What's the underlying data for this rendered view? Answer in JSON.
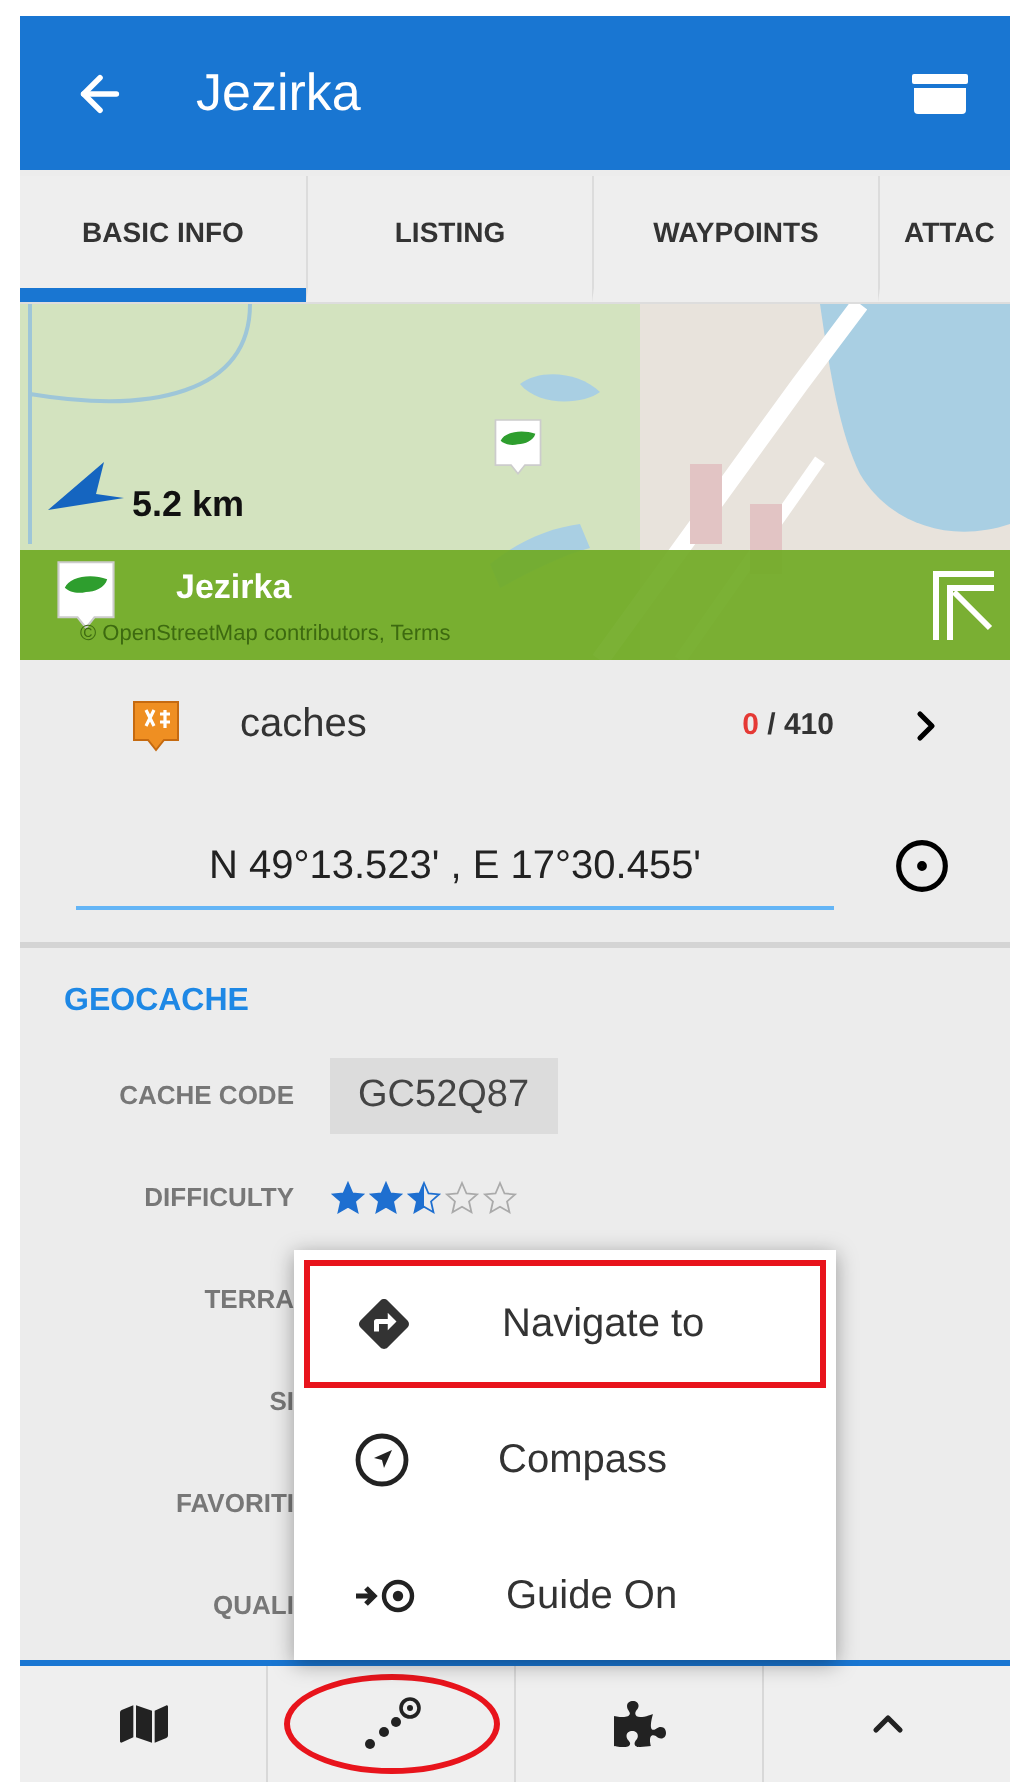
{
  "app_bar": {
    "title": "Jezirka"
  },
  "tabs": [
    {
      "label": "BASIC INFO",
      "selected": true
    },
    {
      "label": "LISTING",
      "selected": false
    },
    {
      "label": "WAYPOINTS",
      "selected": false
    },
    {
      "label": "ATTAC",
      "selected": false
    }
  ],
  "map": {
    "distance": "5.2 km",
    "cache_name": "Jezirka",
    "attribution": "© OpenStreetMap contributors, Terms"
  },
  "caches_row": {
    "label": "caches",
    "found": "0",
    "total": "/ 410"
  },
  "coordinates": {
    "value": "N 49°13.523' , E 17°30.455'"
  },
  "geocache": {
    "heading": "GEOCACHE",
    "rows": [
      {
        "kind": "code",
        "label": "CACHE CODE",
        "value": "GC52Q87"
      },
      {
        "kind": "stars",
        "label": "DIFFICULTY",
        "stars": 2.5
      },
      {
        "kind": "label",
        "label": "TERRA"
      },
      {
        "kind": "label",
        "label": "SI"
      },
      {
        "kind": "label",
        "label": "FAVORITI"
      },
      {
        "kind": "label",
        "label": "QUALI"
      }
    ]
  },
  "menu": {
    "items": [
      {
        "kind": "navigate",
        "label": "Navigate to",
        "highlighted": true
      },
      {
        "kind": "compass",
        "label": "Compass",
        "highlighted": false
      },
      {
        "kind": "guide",
        "label": "Guide On",
        "highlighted": false
      }
    ]
  },
  "bottom_bar": {
    "items": [
      {
        "kind": "map",
        "highlighted": false
      },
      {
        "kind": "route",
        "highlighted": true
      },
      {
        "kind": "addons",
        "highlighted": false
      },
      {
        "kind": "more",
        "highlighted": false
      }
    ]
  }
}
